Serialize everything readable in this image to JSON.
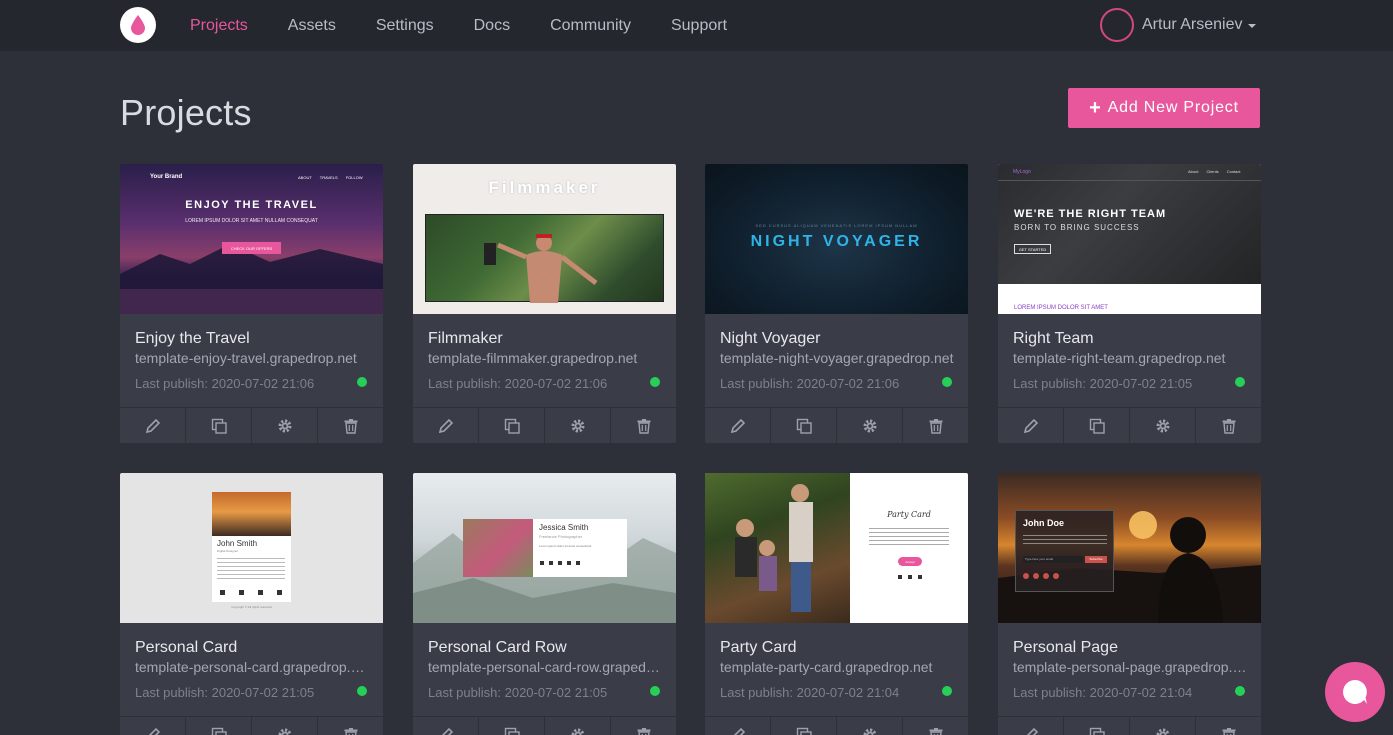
{
  "nav": {
    "items": [
      "Projects",
      "Assets",
      "Settings",
      "Docs",
      "Community",
      "Support"
    ],
    "active": "Projects",
    "user_name": "Artur Arseniev"
  },
  "page": {
    "title": "Projects",
    "add_button": "Add New Project"
  },
  "colors": {
    "accent": "#e8579c",
    "status_online": "#26d058",
    "background": "#2e3039",
    "card": "#3a3d47"
  },
  "projects": [
    {
      "name": "Enjoy the Travel",
      "url": "template-enjoy-travel.grapedrop.net",
      "last_publish": "Last publish: 2020-07-02 21:06",
      "thumb": {
        "brand": "Your Brand",
        "menu": [
          "ABOUT",
          "TRAVELS",
          "FOLLOW"
        ],
        "heading": "ENJOY THE TRAVEL",
        "sub": "LOREM IPSUM DOLOR SIT AMET NULLAM CONSEQUAT",
        "button": "CHECK OUR OFFERS"
      }
    },
    {
      "name": "Filmmaker",
      "url": "template-filmmaker.grapedrop.net",
      "last_publish": "Last publish: 2020-07-02 21:06",
      "thumb": {
        "heading": "Filmmaker"
      }
    },
    {
      "name": "Night Voyager",
      "url": "template-night-voyager.grapedrop.net",
      "last_publish": "Last publish: 2020-07-02 21:06",
      "thumb": {
        "sub": "SED CURSUS ALIQUAM VENENATIS LOREM IPSUM NULLAM",
        "heading": "NIGHT VOYAGER"
      }
    },
    {
      "name": "Right Team",
      "url": "template-right-team.grapedrop.net",
      "last_publish": "Last publish: 2020-07-02 21:05",
      "thumb": {
        "brand": "MyLogo",
        "menu": [
          "About",
          "Clients",
          "Contact"
        ],
        "heading": "WE'RE THE RIGHT TEAM",
        "sub": "BORN TO BRING SUCCESS",
        "button": "GET STARTED",
        "footer": "LOREM IPSUM DOLOR SIT AMET"
      }
    },
    {
      "name": "Personal Card",
      "url": "template-personal-card.grapedrop.net",
      "last_publish": "Last publish: 2020-07-02 21:05",
      "thumb": {
        "heading": "John Smith",
        "sub": "Digital Designer",
        "footer": "Copyright © All rights reserved"
      }
    },
    {
      "name": "Personal Card Row",
      "url": "template-personal-card-row.grapedrop.net",
      "last_publish": "Last publish: 2020-07-02 21:05",
      "thumb": {
        "heading": "Jessica Smith",
        "sub": "Freelance Photographer",
        "body": "Lorem ipsum dolor sit amet consectetur"
      }
    },
    {
      "name": "Party Card",
      "url": "template-party-card.grapedrop.net",
      "last_publish": "Last publish: 2020-07-02 21:04",
      "thumb": {
        "heading": "Party Card",
        "button": "Accept"
      }
    },
    {
      "name": "Personal Page",
      "url": "template-personal-page.grapedrop.net",
      "last_publish": "Last publish: 2020-07-02 21:04",
      "thumb": {
        "heading": "John Doe",
        "input": "Type here your email",
        "button": "Subscribe"
      }
    }
  ],
  "card_actions": [
    "edit-icon",
    "duplicate-icon",
    "settings-gear-icon",
    "trash-icon"
  ]
}
